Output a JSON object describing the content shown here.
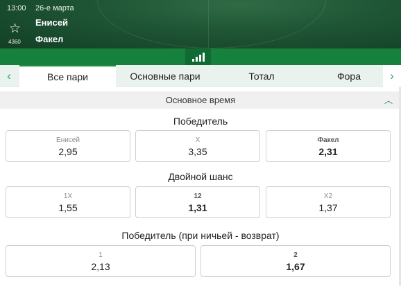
{
  "header": {
    "time": "13:00",
    "date": "26-е марта",
    "favorite_count": "4360",
    "team_home": "Енисей",
    "team_away": "Факел"
  },
  "stats_icon": "bar-chart-icon",
  "tabs": [
    {
      "label": "Все пари",
      "active": true
    },
    {
      "label": "Основные пари",
      "active": false
    },
    {
      "label": "Тотал",
      "active": false
    },
    {
      "label": "Фора",
      "active": false
    }
  ],
  "section": {
    "title": "Основное время"
  },
  "markets": [
    {
      "title": "Победитель",
      "outcomes": [
        {
          "label": "Енисей",
          "odds": "2,95"
        },
        {
          "label": "X",
          "odds": "3,35"
        },
        {
          "label": "Факел",
          "odds": "2,31"
        }
      ]
    },
    {
      "title": "Двойной шанс",
      "outcomes": [
        {
          "label": "1X",
          "odds": "1,55"
        },
        {
          "label": "12",
          "odds": "1,31"
        },
        {
          "label": "X2",
          "odds": "1,37"
        }
      ]
    },
    {
      "title": "Победитель (при ничьей - возврат)",
      "outcomes": [
        {
          "label": "1",
          "odds": "2,13"
        },
        {
          "label": "2",
          "odds": "1,67"
        }
      ]
    }
  ],
  "colors": {
    "header_bg": "#1e5434",
    "accent": "#16813d",
    "tabs_bg": "#e9f2ec"
  }
}
